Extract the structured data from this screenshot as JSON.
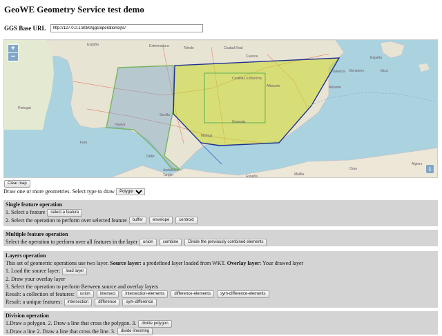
{
  "page": {
    "title": "GeoWE Geometry Service test demo"
  },
  "base": {
    "label": "GGS Base URL",
    "url": "http://127.0.0.1:8080/ggs/operations/jts/"
  },
  "map": {
    "zoom_in": "+",
    "zoom_out": "−",
    "info": "i",
    "labels": [
      "Ciudad Real",
      "Toledo",
      "Cuenca",
      "Albacete",
      "Valencia",
      "Extremadura",
      "Andalucía",
      "Castilla-La Mancha",
      "Sevilla",
      "Granada",
      "Málaga",
      "Cádiz",
      "Huelva",
      "España",
      "España",
      "Tanger",
      "Melilla",
      "Alicante",
      "Benidorm",
      "Ibiza",
      "Algiers",
      "Oran",
      "España",
      "Faro",
      "Portugal"
    ]
  },
  "clear_map": "Clear map",
  "draw_row": {
    "text": "Draw one or more geometries. Select type to draw",
    "selected": "Polygon"
  },
  "single": {
    "title": "Single feature operation",
    "step1": "1. Select a feature",
    "select_btn": "select a feature",
    "step2": "2. Select the operation to perform over selected feature",
    "buttons": [
      "buffer",
      "envelope",
      "centroid"
    ]
  },
  "multiple": {
    "title": "Multiple feature operation",
    "text": "Select the operation to perform over all features in the layer",
    "buttons": [
      "union",
      "combine",
      "Divide the previously combined elements"
    ]
  },
  "layers": {
    "title": "Layers operation",
    "desc_pre": "This set of geometric operations use two layer.",
    "source_label": "Source layer:",
    "source_text": "a predefined layer loaded from WKT.",
    "overlay_label": "Overlay layer:",
    "overlay_text": "Your drawed layer",
    "step1": "1. Load the source layer:",
    "load_btn": "load layer",
    "step2": "2. Draw your overlay layer",
    "step3": "3. Select the operation to perform Between source and overlay layers",
    "collection_label": "Result: a collection of features:",
    "collection_buttons": [
      "union",
      "intersect",
      "intersection-elements",
      "difference-elements",
      "sym-difference-elements"
    ],
    "unique_label": "Result: a unique features:",
    "unique_buttons": [
      "intersection",
      "difference",
      "sym-difference"
    ]
  },
  "division": {
    "title": "Division operation",
    "line1": "1.Draw a polygon. 2. Draw a line that cross the polygon. 3.",
    "btn1": "divide polygon",
    "line2": "1.Draw a line 2. Draw a line that cross the line. 3.",
    "btn2": "divide linestring"
  }
}
